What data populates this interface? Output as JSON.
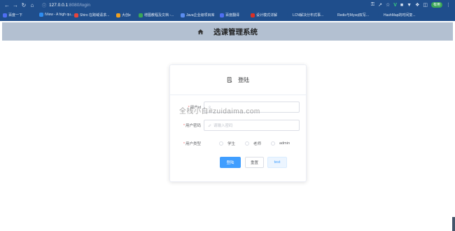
{
  "browser": {
    "url_host": "127.0.0.1",
    "url_path": ":8080/login",
    "bookmarks": [
      {
        "label": "百度一下",
        "color": "#4e6ef2"
      },
      {
        "label": "iView - A high qu...",
        "color": "#2d8cf0"
      },
      {
        "label": "Shiro 在跨域请求...",
        "color": "#e8453c"
      },
      {
        "label": "大创e",
        "color": "#f0a020"
      },
      {
        "label": "增图教程及文档 -...",
        "color": "#3aa757"
      },
      {
        "label": "Java企业级项目库",
        "color": "#5b8def"
      },
      {
        "label": "百度翻译",
        "color": "#4e6ef2"
      },
      {
        "label": "设计模式详解",
        "color": "#d93025"
      },
      {
        "label": "LCN解决分布式事...",
        "color": "#1f4e8c"
      },
      {
        "label": "Redis与Mysql双写...",
        "color": "#1f4e8c"
      },
      {
        "label": "HashMap的时间复...",
        "color": "#1f4e8c"
      }
    ],
    "ext_pill": "有用"
  },
  "app": {
    "title": "选课管理系统"
  },
  "login": {
    "title": "登陆",
    "user_id_label": "用户id",
    "password_label": "用户密码",
    "password_placeholder": "请输入密码",
    "user_type_label": "用户类型",
    "user_types": [
      "学生",
      "老师",
      "admin"
    ],
    "login_button": "登陆",
    "reset_button": "重置",
    "test_button": "test"
  },
  "watermark": "全栈小白#zuidaima.com",
  "colors": {
    "header_bg": "#b3c0d1",
    "primary": "#409eff",
    "browser_bg": "#1f4e8c"
  }
}
